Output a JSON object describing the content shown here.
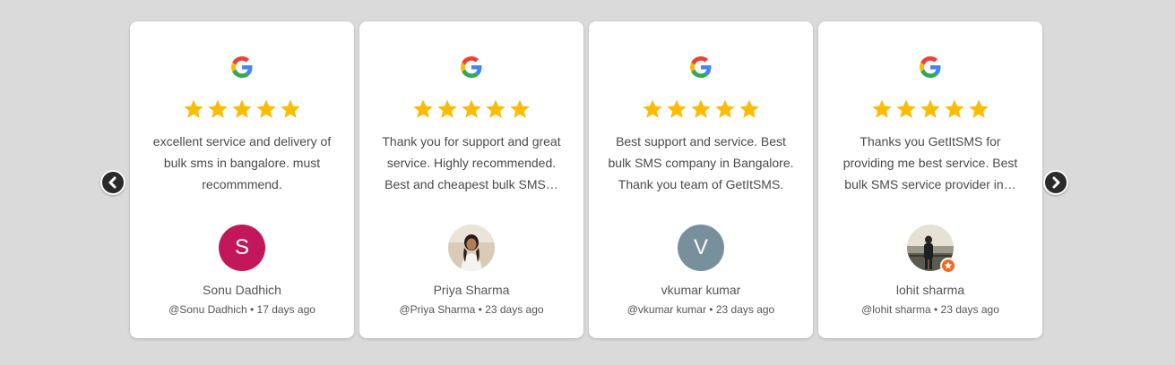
{
  "reviews": [
    {
      "text": "excellent service and delivery of bulk sms in bangalore. must recommmend.",
      "rating": 5,
      "avatar_letter": "S",
      "avatar_color": "#c2185b",
      "name": "Sonu Dadhich",
      "handle": "@Sonu Dadhich",
      "time": "17 days ago"
    },
    {
      "text": "Thank you for support and great service. Highly recommended. Best and cheapest bulk SMS…",
      "rating": 5,
      "avatar_letter": "",
      "name": "Priya Sharma",
      "handle": "@Priya Sharma",
      "time": "23 days ago"
    },
    {
      "text": "Best support and service. Best bulk SMS company in Bangalore. Thank you team of GetItSMS.",
      "rating": 5,
      "avatar_letter": "V",
      "avatar_color": "#78909c",
      "name": "vkumar kumar",
      "handle": "@vkumar kumar",
      "time": "23 days ago"
    },
    {
      "text": "Thanks you GetItSMS for providing me best service. Best bulk SMS service provider in…",
      "rating": 5,
      "avatar_letter": "",
      "name": "lohit sharma",
      "handle": "@lohit sharma",
      "time": "23 days ago"
    }
  ],
  "separator": "•",
  "colors": {
    "star": "#fbbc05",
    "background": "#dadada",
    "card": "#ffffff"
  },
  "icons": {
    "prev": "chevron-left-icon",
    "next": "chevron-right-icon",
    "source": "google-icon"
  }
}
